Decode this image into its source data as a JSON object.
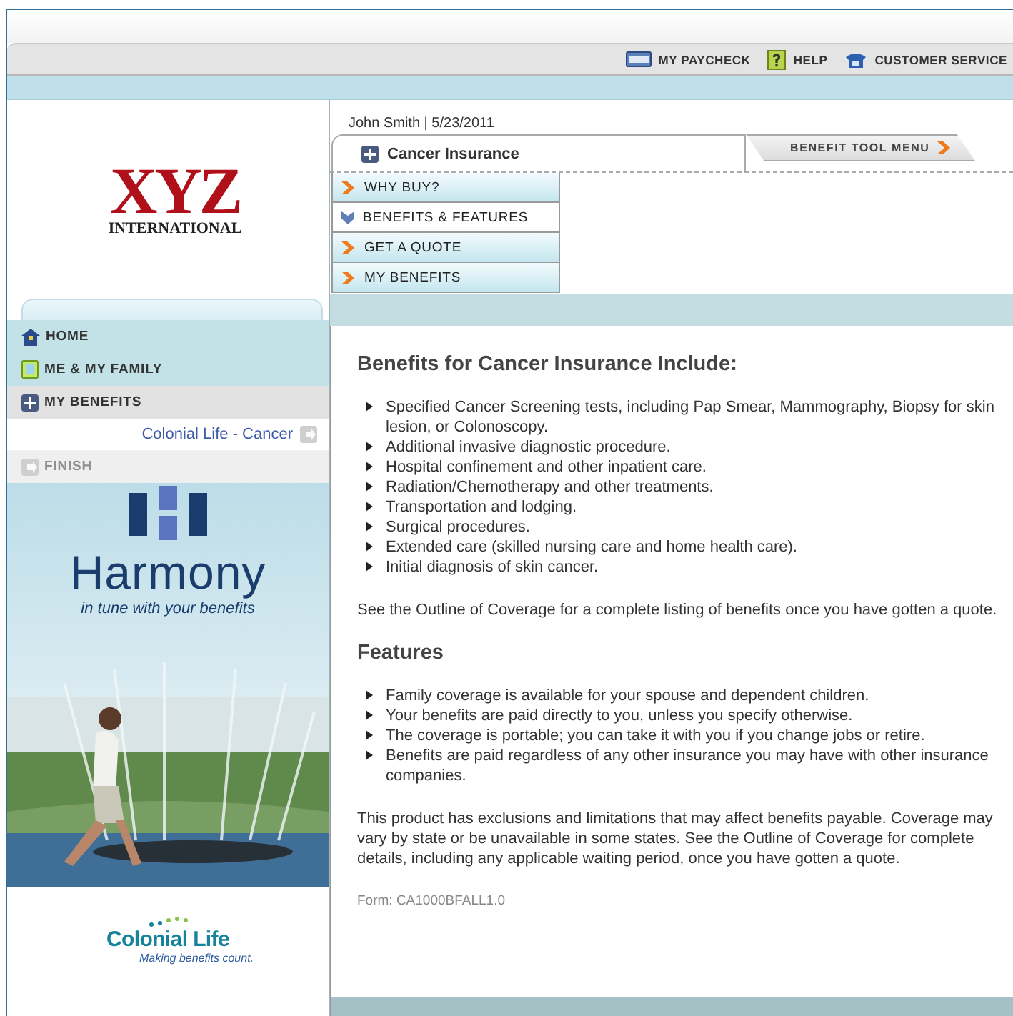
{
  "toolbar": [
    {
      "label": "MY PAYCHECK",
      "kind": "paycheck"
    },
    {
      "label": "HELP",
      "kind": "help"
    },
    {
      "label": "CUSTOMER SERVICE",
      "kind": "phone"
    }
  ],
  "logo": {
    "name": "XYZ",
    "subtitle": "INTERNATIONAL"
  },
  "nav": [
    {
      "label": "HOME",
      "kind": "home",
      "selected": false,
      "disabled": false
    },
    {
      "label": "ME & MY FAMILY",
      "kind": "family",
      "selected": false,
      "disabled": false
    },
    {
      "label": "MY BENEFITS",
      "kind": "benefits",
      "selected": true,
      "disabled": false,
      "children": [
        {
          "label": "Colonial Life - Cancer"
        }
      ]
    },
    {
      "label": "FINISH",
      "kind": "finish",
      "selected": false,
      "disabled": true
    }
  ],
  "banner": {
    "title": "Harmony",
    "tagline": "in tune with your benefits"
  },
  "brand": {
    "name": "Colonial Life",
    "tagline": "Making benefits count."
  },
  "user_line": "John Smith | 5/23/2011",
  "product_tab": "Cancer Insurance",
  "tool_menu": "BENEFIT TOOL MENU",
  "menu": [
    {
      "label": "WHY BUY?",
      "selected": false
    },
    {
      "label": "BENEFITS & FEATURES",
      "selected": true
    },
    {
      "label": "GET A QUOTE",
      "selected": false
    },
    {
      "label": "MY BENEFITS",
      "selected": false
    }
  ],
  "content": {
    "heading": "Benefits for Cancer Insurance Include:",
    "benefits": [
      "Specified Cancer Screening tests, including Pap Smear, Mammography, Biopsy for skin lesion, or Colonoscopy.",
      "Additional invasive diagnostic procedure.",
      "Hospital confinement and other inpatient care.",
      "Radiation/Chemotherapy and other treatments.",
      "Transportation and lodging.",
      "Surgical procedures.",
      "Extended care (skilled nursing care and home health care).",
      "Initial diagnosis of skin cancer."
    ],
    "note": "See the Outline of Coverage for a complete listing of benefits once you have gotten a quote.",
    "features_heading": "Features",
    "features": [
      "Family coverage is available for your spouse and dependent children.",
      "Your benefits are paid directly to you, unless you specify otherwise.",
      "The coverage is portable; you can take it with you if you change jobs or retire.",
      "Benefits are paid regardless of any other insurance you may have with other insurance companies."
    ],
    "disclaimer": "This product has exclusions and limitations that may affect benefits payable. Coverage may vary by state or be unavailable in some states. See the Outline of Coverage for complete details, including any applicable waiting period, once you have gotten a quote.",
    "form": "Form: CA1000BFALL1.0"
  }
}
